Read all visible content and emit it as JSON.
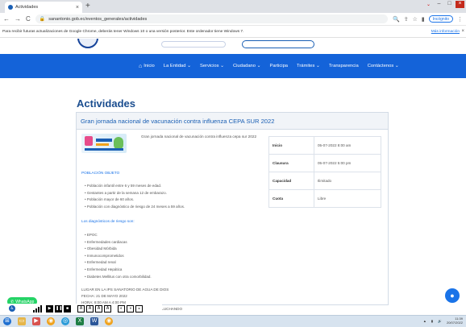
{
  "browser": {
    "tab_title": "Actividades",
    "url": "sanantonio.gob.ec/eventos_generales/actividades",
    "incognito_label": "Incógnito",
    "info_message": "Para recibir futuras actualizaciones de Google Chrome, deberás tener Windows 10 o una versión posterior. Este ordenador tiene Windows 7.",
    "info_link": "Más información"
  },
  "nav": {
    "items": [
      {
        "label": "Inicio"
      },
      {
        "label": "La Entidad ⌄"
      },
      {
        "label": "Servicios ⌄"
      },
      {
        "label": "Ciudadano ⌄"
      },
      {
        "label": "Participa"
      },
      {
        "label": "Trámites ⌄"
      },
      {
        "label": "Transparencia"
      },
      {
        "label": "Contáctenos ⌄"
      }
    ]
  },
  "page": {
    "title": "Actividades",
    "event": {
      "title": "Gran jornada nacional de vacunación contra influenza CEPA SUR 2022",
      "lead": "Gran jornada nacional de vacunación contra influenza cepa sur 2022",
      "poblacion_title": "POBLACIÓN OBJETO",
      "poblacion": [
        "Población infantil entre 6 y 59 meses de edad.",
        "Gestantes a partir de la semana 12 de embarazo.",
        "Población mayor de 60 años.",
        "Población con diagnóstico de riesgo de 24 meses a 59 años."
      ],
      "riesgo_title": "Los diagnósticos de riesgo son:",
      "riesgo": [
        "EPOC",
        "Enfermedades cardiacas",
        "Obesidad Mórbida",
        "Inmunocomprometidos",
        "Enfermedad renal",
        "Enfermedad Hepática",
        "Diabetes Mellitus con otra comorbilidad."
      ],
      "lugar": "LUGAR EN LA IPS SANATORIO DE AGUA DE DIOS",
      "fecha": "FECHA: 21 DE MAYO 2022",
      "hora": "HORA: 8:00 AM A 4:00 PM",
      "extra": "SANANDRO VACUNANDO PORTU VIDA ESTA LUCHANDO"
    },
    "details": [
      {
        "key": "Inicio",
        "value": "05-07-2022 8:00 am"
      },
      {
        "key": "Clausura",
        "value": "05-07-2022 5:00 pm"
      },
      {
        "key": "Capacidad",
        "value": "Ilimitado"
      },
      {
        "key": "Cuota",
        "value": "Libre"
      }
    ]
  },
  "overlays": {
    "whatsapp_label": "WhatsApp",
    "toolbar_buttons": [
      "▶",
      "❚❚",
      "■",
      "A",
      "A",
      "A",
      "A",
      "◐",
      "◑",
      "◒"
    ]
  },
  "taskbar": {
    "time": "11:39",
    "date": "20/07/2022"
  },
  "colors": {
    "nav_blue": "#1463d9",
    "title_blue": "#1a4d8f",
    "link_blue": "#1a73e8",
    "whatsapp_green": "#25d366"
  }
}
